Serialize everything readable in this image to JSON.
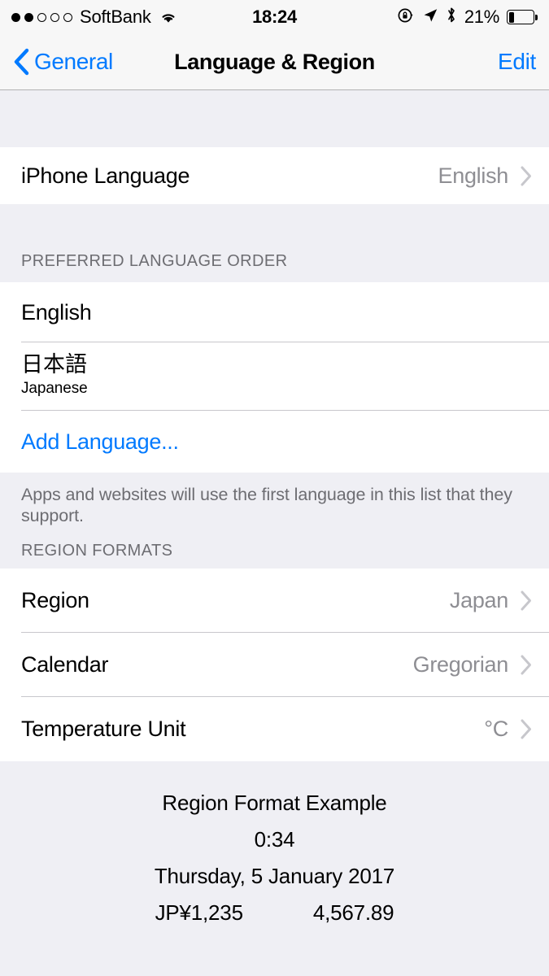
{
  "status_bar": {
    "carrier": "SoftBank",
    "signal_dots_filled": 2,
    "signal_dots_total": 5,
    "wifi_icon": "wifi-icon",
    "time": "18:24",
    "rotation_lock_icon": "rotation-lock-icon",
    "location_icon": "location-arrow-icon",
    "bluetooth_icon": "bluetooth-icon",
    "battery_percent": "21%",
    "battery_level": 21
  },
  "nav": {
    "back_label": "General",
    "back_icon": "chevron-left-icon",
    "title": "Language & Region",
    "edit_label": "Edit"
  },
  "sections": {
    "iphone_language": {
      "label": "iPhone Language",
      "value": "English"
    },
    "preferred_language_order": {
      "header": "PREFERRED LANGUAGE ORDER",
      "items": [
        {
          "label": "English",
          "subtitle": ""
        },
        {
          "label": "日本語",
          "subtitle": "Japanese"
        }
      ],
      "add_language_label": "Add Language...",
      "footer": "Apps and websites will use the first language in this list that they support."
    },
    "region_formats": {
      "header": "REGION FORMATS",
      "rows": [
        {
          "label": "Region",
          "value": "Japan"
        },
        {
          "label": "Calendar",
          "value": "Gregorian"
        },
        {
          "label": "Temperature Unit",
          "value": "°C"
        }
      ]
    },
    "region_format_example": {
      "title": "Region Format Example",
      "time": "0:34",
      "date": "Thursday, 5 January 2017",
      "currency": "JP¥1,235",
      "number": "4,567.89"
    }
  },
  "colors": {
    "accent": "#007aff",
    "value_gray": "#8e8e93",
    "group_bg": "#efeff4",
    "row_bg": "#ffffff",
    "separator": "#c8c7cc"
  }
}
